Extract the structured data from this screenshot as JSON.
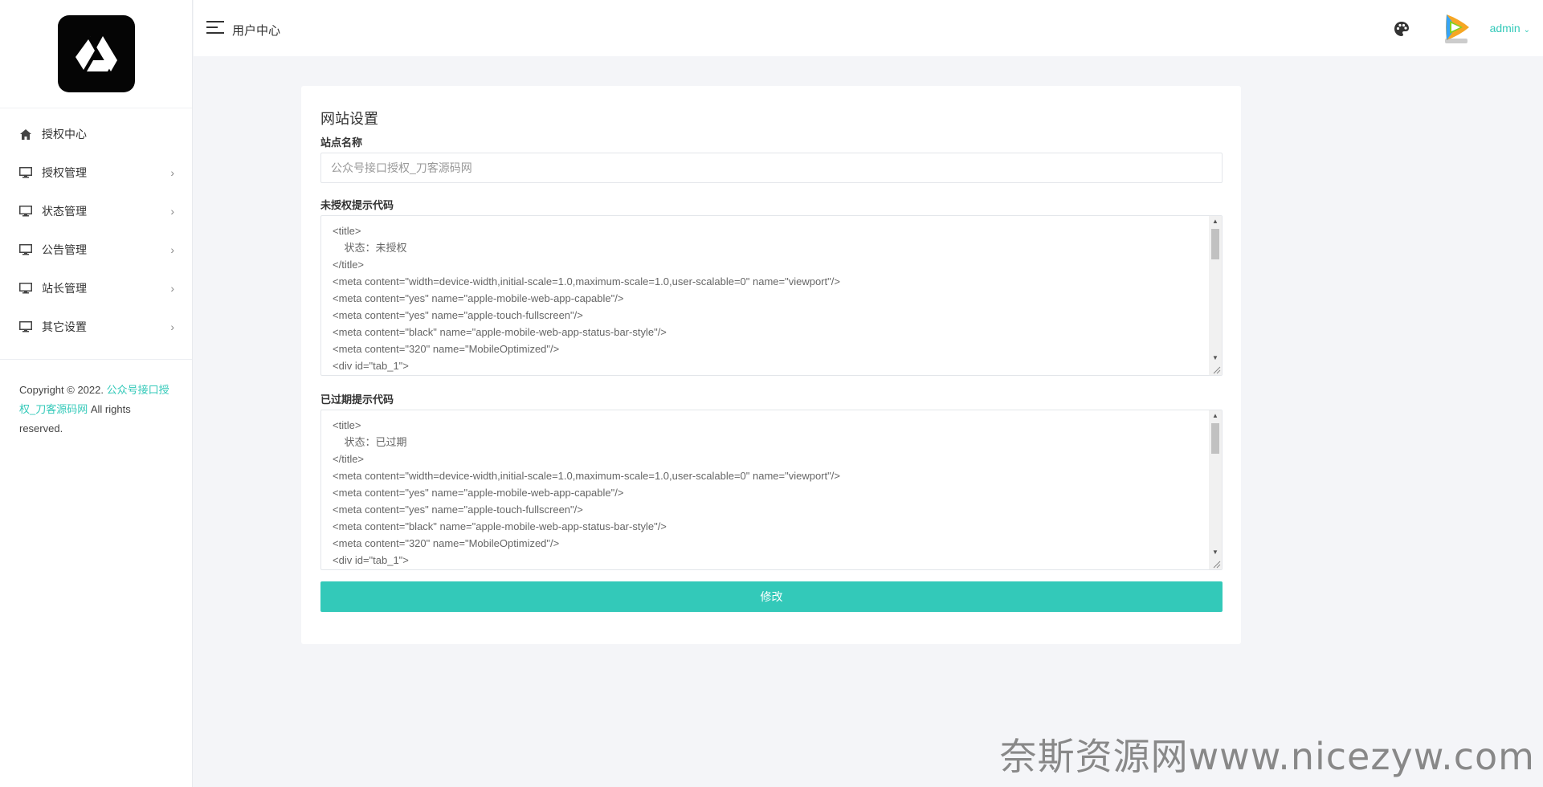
{
  "sidebar": {
    "items": [
      {
        "label": "授权中心",
        "icon": "home-icon",
        "has_children": false
      },
      {
        "label": "授权管理",
        "icon": "monitor-icon",
        "has_children": true
      },
      {
        "label": "状态管理",
        "icon": "monitor-icon",
        "has_children": true
      },
      {
        "label": "公告管理",
        "icon": "monitor-icon",
        "has_children": true
      },
      {
        "label": "站长管理",
        "icon": "monitor-icon",
        "has_children": true
      },
      {
        "label": "其它设置",
        "icon": "monitor-icon",
        "has_children": true
      }
    ],
    "chevron": "›",
    "copyright": {
      "prefix": "Copyright © 2022. ",
      "link": "公众号接口授权_刀客源码网",
      "suffix": " All rights reserved."
    }
  },
  "topbar": {
    "title": "用户中心",
    "user": "admin"
  },
  "form": {
    "title": "网站设置",
    "site_name_label": "站点名称",
    "site_name_value": "公众号接口授权_刀客源码网",
    "unauth_label": "未授权提示代码",
    "unauth_code": "<title>\n    状态：未授权\n</title>\n<meta content=\"width=device-width,initial-scale=1.0,maximum-scale=1.0,user-scalable=0\" name=\"viewport\"/>\n<meta content=\"yes\" name=\"apple-mobile-web-app-capable\"/>\n<meta content=\"yes\" name=\"apple-touch-fullscreen\"/>\n<meta content=\"black\" name=\"apple-mobile-web-app-status-bar-style\"/>\n<meta content=\"320\" name=\"MobileOptimized\"/>\n<div id=\"tab_1\">",
    "expired_label": "已过期提示代码",
    "expired_code": "<title>\n    状态：已过期\n</title>\n<meta content=\"width=device-width,initial-scale=1.0,maximum-scale=1.0,user-scalable=0\" name=\"viewport\"/>\n<meta content=\"yes\" name=\"apple-mobile-web-app-capable\"/>\n<meta content=\"yes\" name=\"apple-touch-fullscreen\"/>\n<meta content=\"black\" name=\"apple-mobile-web-app-status-bar-style\"/>\n<meta content=\"320\" name=\"MobileOptimized\"/>\n<div id=\"tab_1\">",
    "submit_label": "修改"
  },
  "watermark": "奈斯资源网www.nicezyw.com",
  "colors": {
    "accent": "#33c9b9",
    "background": "#f4f5f8"
  }
}
